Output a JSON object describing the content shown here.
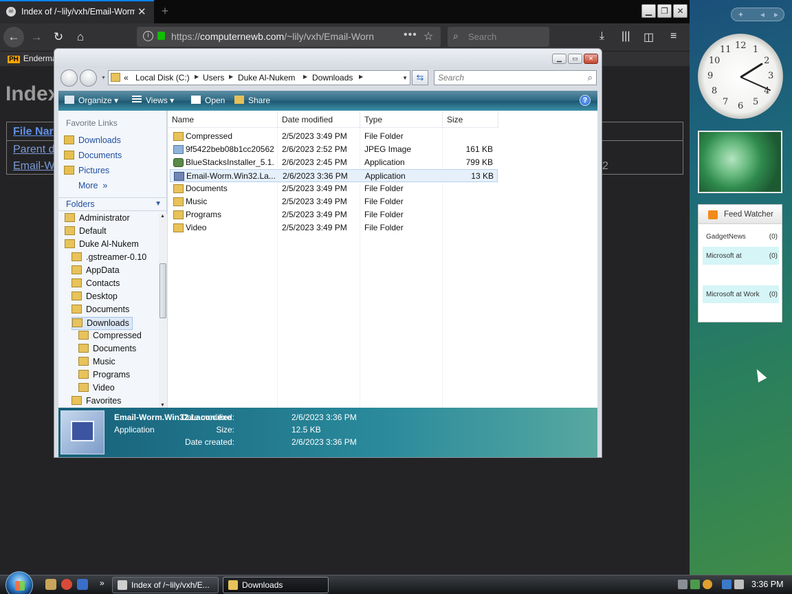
{
  "browser": {
    "tab_title": "Index of /~lily/vxh/Email-Worm",
    "url_host": "computernewb.com",
    "url_scheme": "https://",
    "url_path": "/~lily/vxh/Email-Worn",
    "search_placeholder": "Search",
    "bookmark_label": "Enderma",
    "bookmark_badge": "PH"
  },
  "page": {
    "title": "Index",
    "col_name": "File Nar",
    "row1": "Parent d",
    "row2": "Email-W",
    "row2_extra": "2"
  },
  "explorer": {
    "breadcrumb": [
      "«",
      "Local Disk (C:)",
      "Users",
      "Duke Al-Nukem",
      "Downloads"
    ],
    "search_placeholder": "Search",
    "toolbar": {
      "organize": "Organize",
      "views": "Views",
      "open": "Open",
      "share": "Share",
      "help": "?"
    },
    "favorites_title": "Favorite Links",
    "favorites": [
      "Downloads",
      "Documents",
      "Pictures",
      "More"
    ],
    "folders_label": "Folders",
    "tree": [
      {
        "label": "Administrator",
        "level": 0
      },
      {
        "label": "Default",
        "level": 0
      },
      {
        "label": "Duke Al-Nukem",
        "level": 0
      },
      {
        "label": ".gstreamer-0.10",
        "level": 1
      },
      {
        "label": "AppData",
        "level": 1
      },
      {
        "label": "Contacts",
        "level": 1
      },
      {
        "label": "Desktop",
        "level": 1
      },
      {
        "label": "Documents",
        "level": 1
      },
      {
        "label": "Downloads",
        "level": 1,
        "selected": true
      },
      {
        "label": "Compressed",
        "level": 2
      },
      {
        "label": "Documents",
        "level": 2
      },
      {
        "label": "Music",
        "level": 2
      },
      {
        "label": "Programs",
        "level": 2
      },
      {
        "label": "Video",
        "level": 2
      },
      {
        "label": "Favorites",
        "level": 1
      }
    ],
    "columns": [
      "Name",
      "Date modified",
      "Type",
      "Size"
    ],
    "files": [
      {
        "name": "Compressed",
        "date": "2/5/2023 3:49 PM",
        "type": "File Folder",
        "size": "",
        "icon": "folder"
      },
      {
        "name": "9f5422beb08b1cc20562...",
        "date": "2/6/2023 2:52 PM",
        "type": "JPEG Image",
        "size": "161 KB",
        "icon": "img"
      },
      {
        "name": "BlueStacksInstaller_5.1...",
        "date": "2/6/2023 2:45 PM",
        "type": "Application",
        "size": "799 KB",
        "icon": "app"
      },
      {
        "name": "Email-Worm.Win32.La...",
        "date": "2/6/2023 3:36 PM",
        "type": "Application",
        "size": "13 KB",
        "icon": "exe",
        "selected": true
      },
      {
        "name": "Documents",
        "date": "2/5/2023 3:49 PM",
        "type": "File Folder",
        "size": "",
        "icon": "folder"
      },
      {
        "name": "Music",
        "date": "2/5/2023 3:49 PM",
        "type": "File Folder",
        "size": "",
        "icon": "folder"
      },
      {
        "name": "Programs",
        "date": "2/5/2023 3:49 PM",
        "type": "File Folder",
        "size": "",
        "icon": "folder"
      },
      {
        "name": "Video",
        "date": "2/5/2023 3:49 PM",
        "type": "File Folder",
        "size": "",
        "icon": "folder"
      }
    ],
    "details": {
      "name": "Email-Worm.Win32.Lacon.exe",
      "type": "Application",
      "date_modified_label": "Date modified:",
      "date_modified": "2/6/2023 3:36 PM",
      "size_label": "Size:",
      "size": "12.5 KB",
      "date_created_label": "Date created:",
      "date_created": "2/6/2023 3:36 PM"
    }
  },
  "sidebar": {
    "add": "+",
    "prev": "◂",
    "next": "▸",
    "clock_numbers": [
      "12",
      "1",
      "2",
      "3",
      "4",
      "5",
      "6",
      "7",
      "8",
      "9",
      "10",
      "11"
    ],
    "feed_title": "Feed Watcher",
    "feeds": [
      {
        "name": "GadgetNews",
        "count": "(0)"
      },
      {
        "name": "Microsoft at",
        "count": "(0)"
      },
      {
        "name": "Microsoft at Work",
        "count": "(0)"
      }
    ]
  },
  "taskbar": {
    "more": "»",
    "buttons": [
      "Index of /~lily/vxh/E...",
      "Downloads"
    ],
    "time": "3:36 PM"
  }
}
